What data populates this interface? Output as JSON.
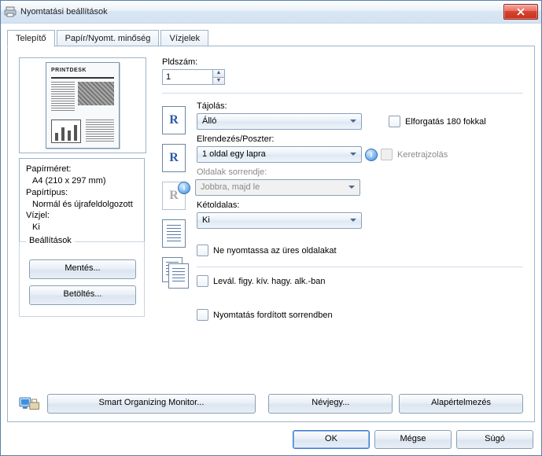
{
  "window": {
    "title": "Nyomtatási beállítások"
  },
  "tabs": {
    "install": "Telepítő",
    "paper": "Papír/Nyomt. minőség",
    "watermarks": "Vízjelek"
  },
  "preview_hdr": "PRINTDESK",
  "info": {
    "paper_size_label": "Papírméret:",
    "paper_size_value": "A4 (210 x 297 mm)",
    "paper_type_label": "Papírtípus:",
    "paper_type_value": "Normál és újrafeldolgozott",
    "watermark_label": "Vízjel:",
    "watermark_value": "Ki"
  },
  "settings_group": {
    "legend": "Beállítások",
    "save": "Mentés...",
    "load": "Betöltés..."
  },
  "right": {
    "copies_label": "Pldszám:",
    "copies_value": "1",
    "orientation_label": "Tájolás:",
    "orientation_value": "Álló",
    "rotate_label": "Elforgatás 180 fokkal",
    "layout_label": "Elrendezés/Poszter:",
    "layout_value": "1 oldal egy lapra",
    "frame_label": "Keretrajzolás",
    "page_order_label": "Oldalak sorrendje:",
    "page_order_value": "Jobbra, majd le",
    "duplex_label": "Kétoldalas:",
    "duplex_value": "Ki",
    "skip_blank_label": "Ne nyomtassa az üres oldalakat",
    "manual_duplex_label": "Levál. figy. kív. hagy. alk.-ban",
    "reverse_label": "Nyomtatás fordított sorrendben"
  },
  "bottom": {
    "som": "Smart Organizing Monitor...",
    "about": "Névjegy...",
    "defaults": "Alapértelmezés"
  },
  "dialog": {
    "ok": "OK",
    "cancel": "Mégse",
    "help": "Súgó"
  }
}
